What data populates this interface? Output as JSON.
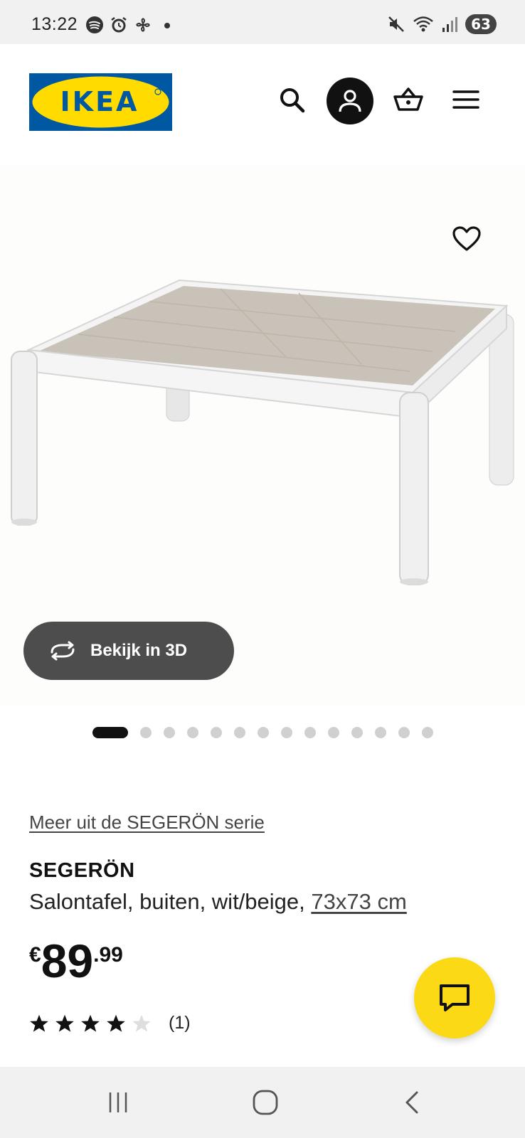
{
  "status_bar": {
    "time": "13:22",
    "battery": "63",
    "icons_left": [
      "spotify-icon",
      "alarm-icon",
      "fan-icon",
      "dot-icon"
    ],
    "icons_right": [
      "mute-icon",
      "wifi-icon",
      "signal-icon",
      "battery-icon"
    ]
  },
  "header": {
    "logo_text": "IKEA",
    "brand_colors": {
      "blue": "#0058a3",
      "yellow": "#ffdb00"
    },
    "icons": [
      "search-icon",
      "profile-icon",
      "cart-icon",
      "menu-icon"
    ]
  },
  "gallery": {
    "view_3d_label": "Bekijk in 3D",
    "total_images": 15,
    "active_index": 0,
    "favorite_icon": "heart-icon"
  },
  "product": {
    "series_link": "Meer uit de SEGERÖN serie",
    "name": "SEGERÖN",
    "description": "Salontafel, buiten, wit/beige, ",
    "size": "73x73 cm",
    "price": {
      "currency": "€",
      "integer": "89",
      "decimal": ".99"
    },
    "rating": {
      "value": 4,
      "max": 5,
      "count": "(1)"
    }
  },
  "chat": {
    "icon": "chat-icon",
    "color": "#fbd914"
  },
  "nav_bar": {
    "icons": [
      "recent-apps-icon",
      "home-icon",
      "back-icon"
    ]
  }
}
